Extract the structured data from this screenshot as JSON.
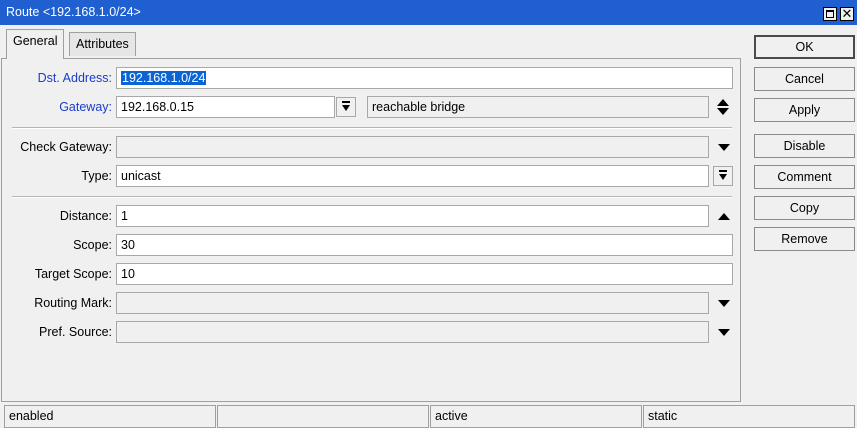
{
  "window": {
    "title": "Route <192.168.1.0/24>"
  },
  "tabs": [
    {
      "label": "General"
    },
    {
      "label": "Attributes"
    }
  ],
  "form": {
    "dst_address": {
      "label": "Dst. Address:",
      "value": "192.168.1.0/24"
    },
    "gateway": {
      "label": "Gateway:",
      "value": "192.168.0.15",
      "status": "reachable bridge"
    },
    "check_gateway": {
      "label": "Check Gateway:",
      "value": ""
    },
    "type": {
      "label": "Type:",
      "value": "unicast"
    },
    "distance": {
      "label": "Distance:",
      "value": "1"
    },
    "scope": {
      "label": "Scope:",
      "value": "30"
    },
    "target_scope": {
      "label": "Target Scope:",
      "value": "10"
    },
    "routing_mark": {
      "label": "Routing Mark:",
      "value": ""
    },
    "pref_source": {
      "label": "Pref. Source:",
      "value": ""
    }
  },
  "buttons": {
    "ok": "OK",
    "cancel": "Cancel",
    "apply": "Apply",
    "disable": "Disable",
    "comment": "Comment",
    "copy": "Copy",
    "remove": "Remove"
  },
  "status": {
    "state": "enabled",
    "blank": "",
    "active": "active",
    "kind": "static"
  },
  "colors": {
    "titlebar": "#1f5fd0",
    "label_link": "#1b3dc9",
    "selection": "#0a64d6"
  }
}
